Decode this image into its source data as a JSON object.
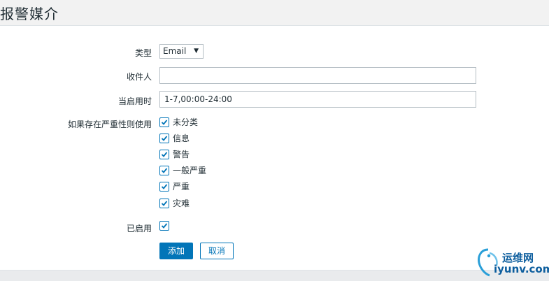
{
  "header": {
    "title": "报警媒介"
  },
  "form": {
    "type": {
      "label": "类型",
      "value": "Email"
    },
    "recipient": {
      "label": "收件人",
      "value": ""
    },
    "when_active": {
      "label": "当启用时",
      "value": "1-7,00:00-24:00"
    },
    "severity": {
      "label": "如果存在严重性则使用",
      "items": [
        {
          "label": "未分类",
          "checked": true
        },
        {
          "label": "信息",
          "checked": true
        },
        {
          "label": "警告",
          "checked": true
        },
        {
          "label": "一般严重",
          "checked": true
        },
        {
          "label": "严重",
          "checked": true
        },
        {
          "label": "灾难",
          "checked": true
        }
      ]
    },
    "enabled": {
      "label": "已启用",
      "checked": true
    }
  },
  "buttons": {
    "add": "添加",
    "cancel": "取消"
  },
  "watermark": {
    "line1": "运维网",
    "line2": "iyunv.com"
  },
  "colors": {
    "accent": "#0275b8",
    "header_bg": "#f2f2f2"
  }
}
